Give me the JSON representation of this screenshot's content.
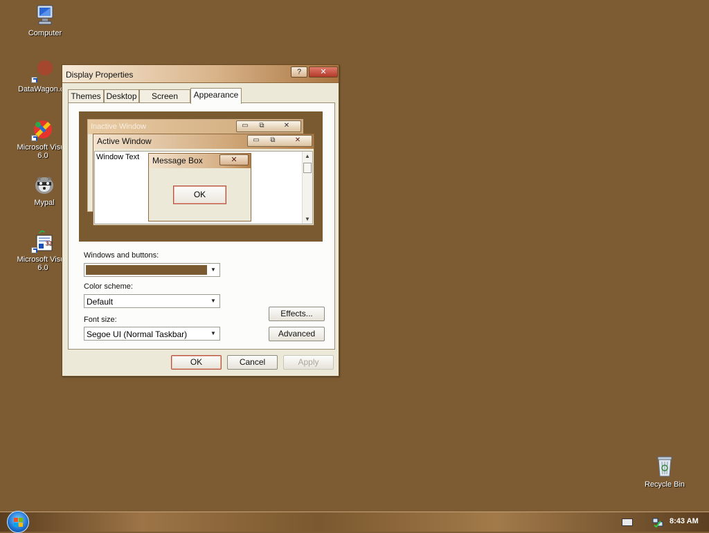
{
  "desktop": {
    "icons": [
      {
        "label": "Computer",
        "icon": "computer-icon"
      },
      {
        "label": "DataWagon.cc",
        "icon": "datawagon-icon"
      },
      {
        "label_line1": "Microsoft Visua",
        "label_line2": "6.0",
        "icon": "visual-studio-icon"
      },
      {
        "label": "Mypal",
        "icon": "mypal-icon"
      },
      {
        "label_line1": "Microsoft Visua",
        "label_line2": "6.0",
        "icon": "visual-foxpro-icon"
      },
      {
        "label": "Recycle Bin",
        "icon": "recycle-bin-icon"
      }
    ]
  },
  "dialog": {
    "title": "Display Properties",
    "help_label": "?",
    "close_label": "✕",
    "tabs": [
      "Themes",
      "Desktop",
      "Screen Saver",
      "Appearance"
    ],
    "active_tab": "Appearance",
    "preview": {
      "inactive_title": "Inactive Window",
      "active_title": "Active Window",
      "window_text": "Window Text",
      "message_title": "Message Box",
      "message_ok": "OK"
    },
    "windows_buttons_label": "Windows and buttons:",
    "windows_buttons_value": "",
    "color_scheme_label": "Color scheme:",
    "color_scheme_value": "Default",
    "font_size_label": "Font size:",
    "font_size_value": "Segoe UI (Normal Taskbar)",
    "effects_label": "Effects...",
    "advanced_label": "Advanced",
    "ok_label": "OK",
    "cancel_label": "Cancel",
    "apply_label": "Apply",
    "theme_color": "#7a5a31"
  },
  "taskbar": {
    "clock": "8:43 AM"
  }
}
